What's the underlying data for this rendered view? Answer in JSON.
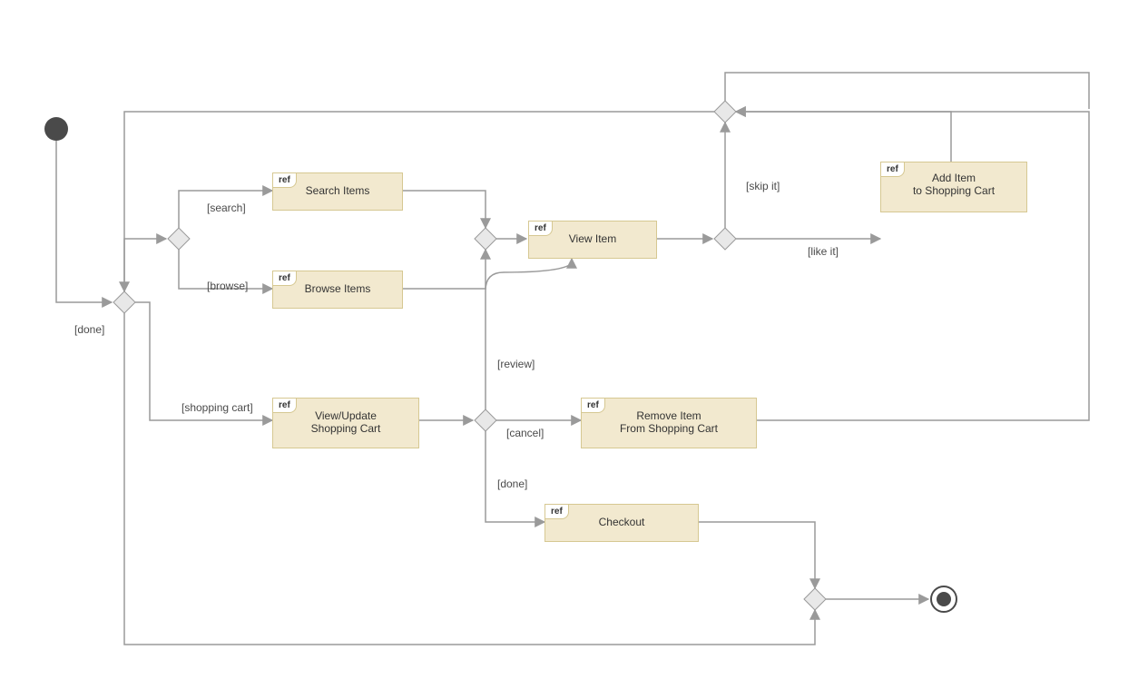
{
  "refs": {
    "search": {
      "tag": "ref",
      "label": "Search Items"
    },
    "browse": {
      "tag": "ref",
      "label": "Browse Items"
    },
    "view": {
      "tag": "ref",
      "label": "View Item"
    },
    "add": {
      "tag": "ref",
      "label": "Add Item\nto Shopping Cart"
    },
    "cart": {
      "tag": "ref",
      "label": "View/Update\nShopping Cart"
    },
    "remove": {
      "tag": "ref",
      "label": "Remove Item\nFrom Shopping Cart"
    },
    "checkout": {
      "tag": "ref",
      "label": "Checkout"
    }
  },
  "guards": {
    "done1": "[done]",
    "search": "[search]",
    "browse": "[browse]",
    "cart": "[shopping cart]",
    "review": "[review]",
    "cancel": "[cancel]",
    "done2": "[done]",
    "skipit": "[skip it]",
    "likeit": "[like it]"
  }
}
